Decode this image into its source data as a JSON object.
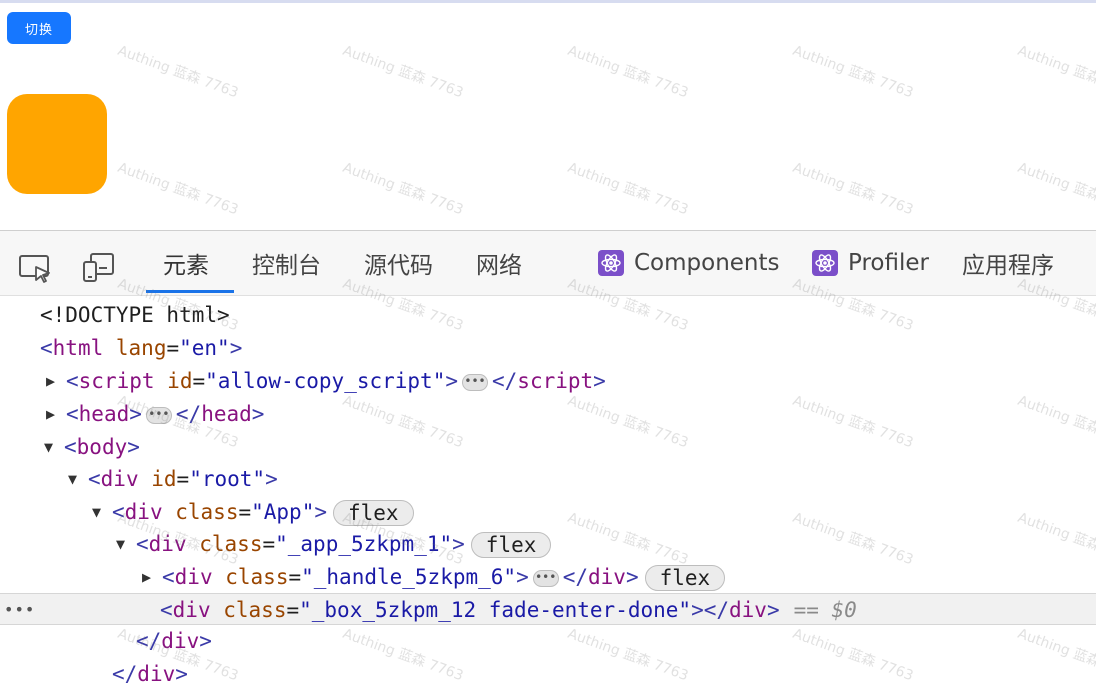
{
  "page": {
    "switch_button": "切换",
    "box_color": "#ffa500"
  },
  "devtools": {
    "icons": [
      "inspect-element-icon",
      "device-toolbar-icon"
    ],
    "tabs": [
      {
        "label": "元素",
        "active": true
      },
      {
        "label": "控制台"
      },
      {
        "label": "源代码"
      },
      {
        "label": "网络"
      },
      {
        "label": "Components",
        "icon": "react-logo-icon"
      },
      {
        "label": "Profiler",
        "icon": "react-logo-icon"
      },
      {
        "label": "应用程序"
      }
    ],
    "accent_color": "#1a73e8"
  },
  "dom_tree": {
    "doctype": "<!DOCTYPE html>",
    "html_tag": "html",
    "html_attr": "lang",
    "html_val": "\"en\"",
    "script_tag": "script",
    "script_attr": "id",
    "script_val": "\"allow-copy_script\"",
    "head_tag": "head",
    "body_tag": "body",
    "root_tag": "div",
    "root_attr": "id",
    "root_val": "\"root\"",
    "app_tag": "div",
    "app_attr": "class",
    "app_val": "\"App\"",
    "app1_tag": "div",
    "app1_attr": "class",
    "app1_val": "\"_app_5zkpm_1\"",
    "handle_tag": "div",
    "handle_attr": "class",
    "handle_val": "\"_handle_5zkpm_6\"",
    "box_tag": "div",
    "box_attr": "class",
    "box_val": "\"_box_5zkpm_12 fade-enter-done\"",
    "close_div": "div",
    "flex_badge": "flex",
    "selected_marker": "== $0",
    "row_menu": "•••",
    "ellipsis": "•••"
  },
  "watermark": "Authing 蓝森 7763"
}
